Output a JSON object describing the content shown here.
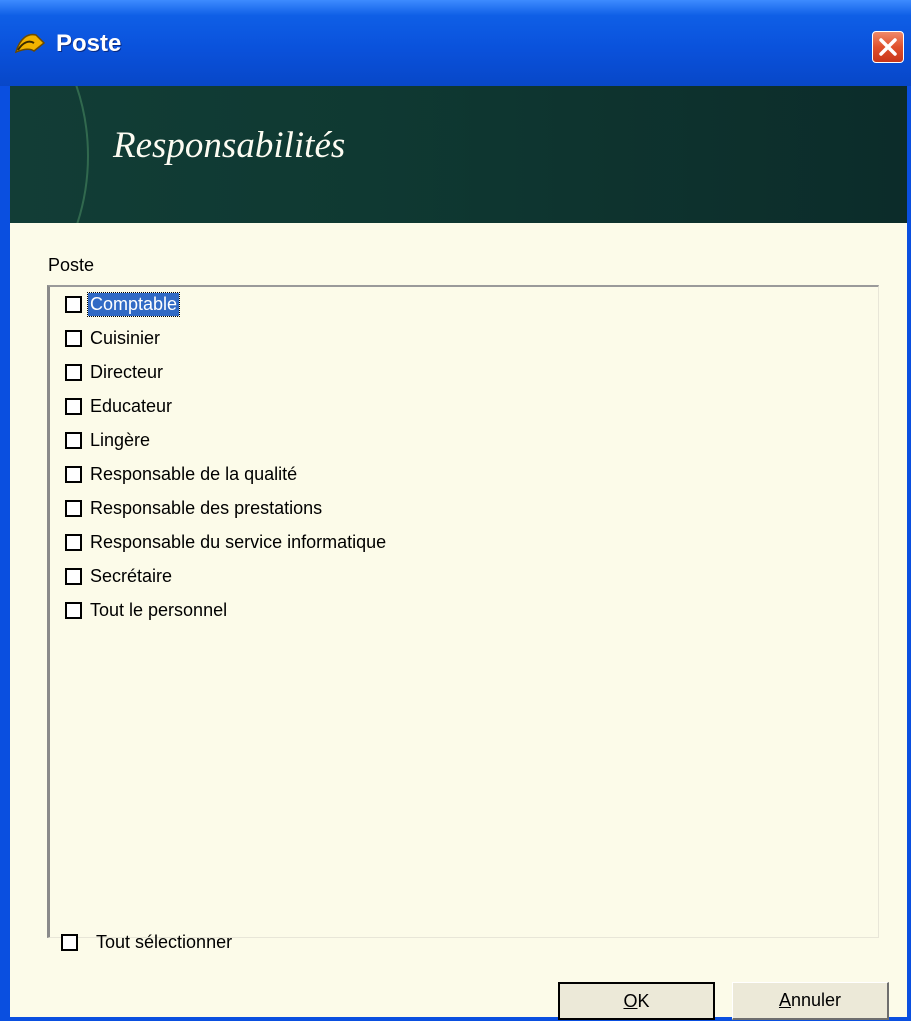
{
  "window": {
    "title": "Poste",
    "close_icon": "close-icon"
  },
  "banner": {
    "title": "Responsabilités"
  },
  "group": {
    "label": "Poste"
  },
  "list": {
    "items": [
      {
        "label": "Comptable",
        "checked": false,
        "selected": true
      },
      {
        "label": "Cuisinier",
        "checked": false,
        "selected": false
      },
      {
        "label": "Directeur",
        "checked": false,
        "selected": false
      },
      {
        "label": "Educateur",
        "checked": false,
        "selected": false
      },
      {
        "label": "Lingère",
        "checked": false,
        "selected": false
      },
      {
        "label": "Responsable de la qualité",
        "checked": false,
        "selected": false
      },
      {
        "label": "Responsable des prestations",
        "checked": false,
        "selected": false
      },
      {
        "label": "Responsable du service informatique",
        "checked": false,
        "selected": false
      },
      {
        "label": "Secrétaire",
        "checked": false,
        "selected": false
      },
      {
        "label": "Tout le personnel",
        "checked": false,
        "selected": false
      }
    ]
  },
  "select_all": {
    "label": "Tout sélectionner",
    "checked": false
  },
  "buttons": {
    "ok": {
      "mnemonic": "O",
      "rest": "K"
    },
    "cancel": {
      "mnemonic": "A",
      "rest": "nnuler"
    }
  },
  "colors": {
    "titlebar": "#0a52dc",
    "banner": "#0f3932",
    "client_bg": "#fcfbe9",
    "selection": "#316ac5",
    "close_button": "#e0502c"
  }
}
